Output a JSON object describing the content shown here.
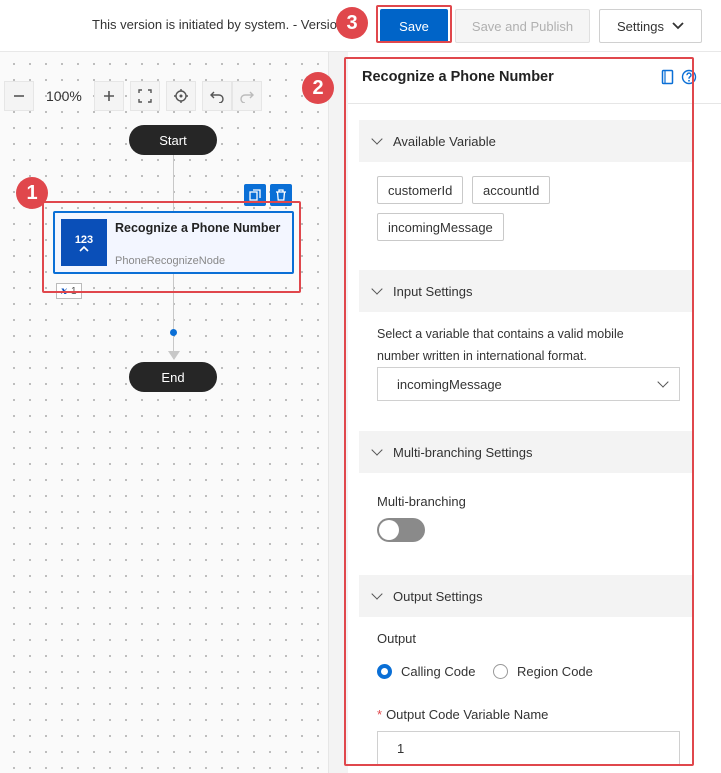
{
  "header": {
    "version_text": "This version is initiated by system. - Version",
    "save_label": "Save",
    "publish_label": "Save and Publish",
    "settings_label": "Settings"
  },
  "canvas": {
    "zoom": "100%",
    "start_label": "Start",
    "end_label": "End",
    "node": {
      "icon_text": "123",
      "title": "Recognize a Phone Number",
      "type": "PhoneRecognizeNode",
      "var_badge": "1"
    }
  },
  "markers": {
    "m1": "1",
    "m2": "2",
    "m3": "3"
  },
  "panel": {
    "title": "Recognize a Phone Number",
    "sections": {
      "available": "Available Variable",
      "input": "Input Settings",
      "multi": "Multi-branching Settings",
      "output": "Output Settings"
    },
    "variables": [
      "customerId",
      "accountId",
      "incomingMessage"
    ],
    "input_desc": "Select a variable that contains a valid mobile number written in international format.",
    "input_value": "incomingMessage",
    "multi_label": "Multi-branching",
    "multi_enabled": false,
    "output_label": "Output",
    "radio_calling": "Calling Code",
    "radio_region": "Region Code",
    "radio_selected": "Calling Code",
    "var_name_label": "Output Code Variable Name",
    "var_name_value": "1"
  },
  "colors": {
    "primary": "#0064c8",
    "highlight": "#e0474c",
    "node_dark": "#262626"
  }
}
